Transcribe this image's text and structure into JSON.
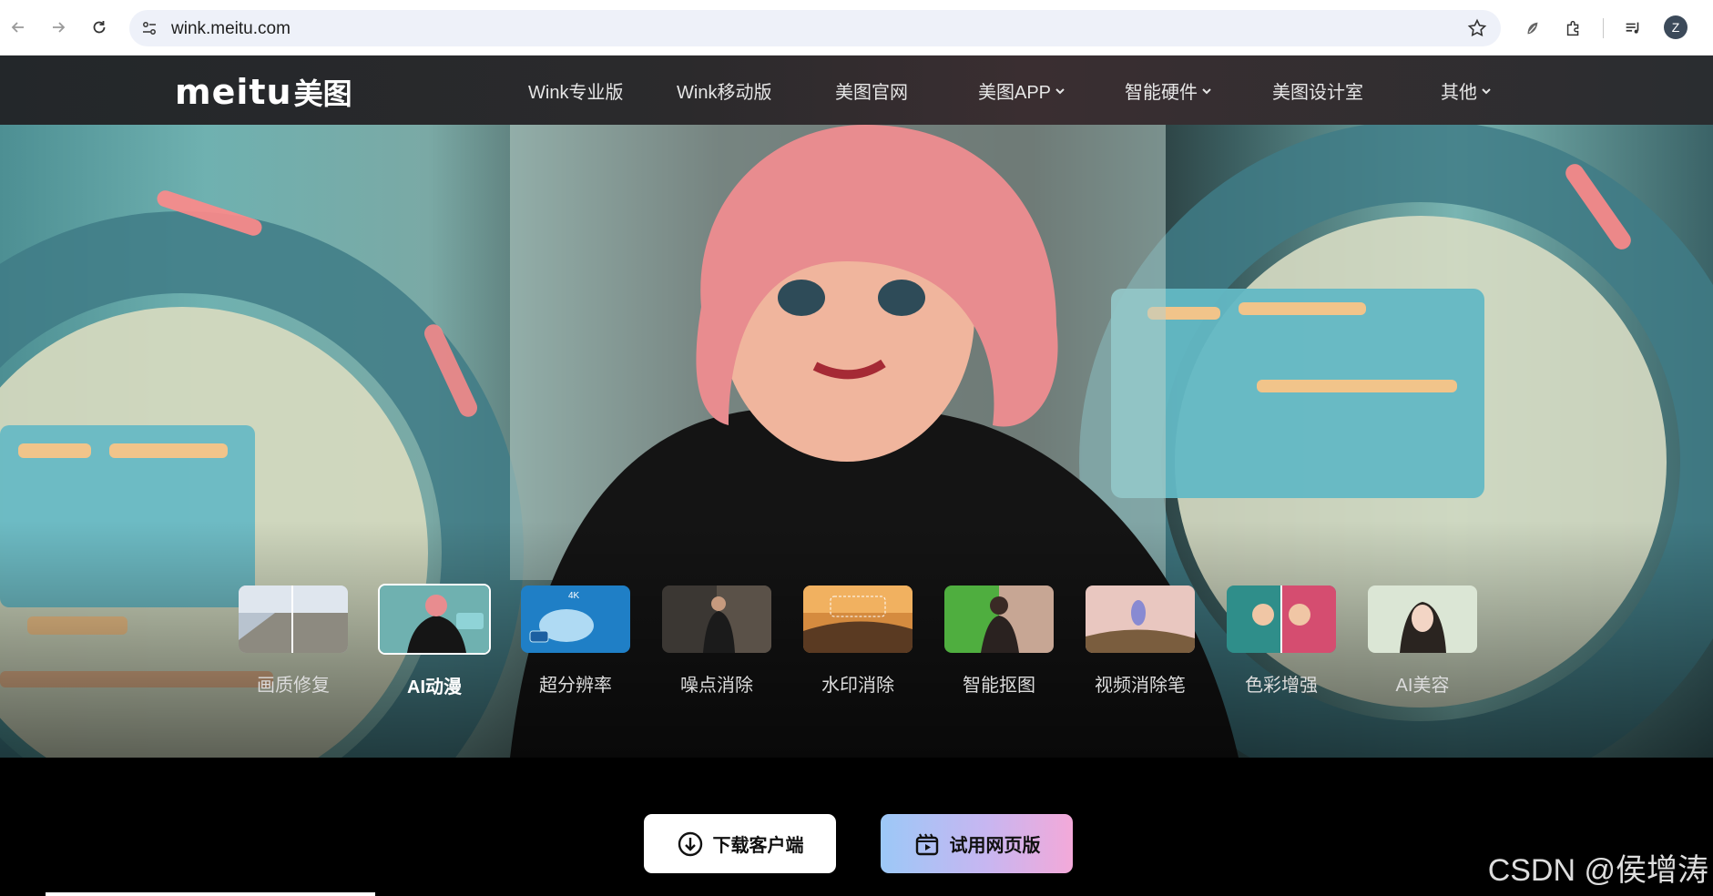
{
  "browser": {
    "url": "wink.meitu.com",
    "profile_initial": "Z"
  },
  "site": {
    "logo_latin": "meitu",
    "logo_cjk": "美图",
    "nav": [
      {
        "label": "Wink专业版"
      },
      {
        "label": "Wink移动版"
      },
      {
        "label": "美图官网"
      },
      {
        "label": "美图APP"
      },
      {
        "label": "智能硬件"
      },
      {
        "label": "美图设计室"
      },
      {
        "label": "其他"
      }
    ]
  },
  "features": [
    {
      "label": "画质修复"
    },
    {
      "label": "AI动漫"
    },
    {
      "label": "超分辨率"
    },
    {
      "label": "噪点消除"
    },
    {
      "label": "水印消除"
    },
    {
      "label": "智能抠图"
    },
    {
      "label": "视频消除笔"
    },
    {
      "label": "色彩增强"
    },
    {
      "label": "AI美容"
    }
  ],
  "active_feature": "AI动漫",
  "thumb_badge": "4K",
  "cta": {
    "download_label": "下载客户端",
    "web_label": "试用网页版"
  },
  "watermark": "CSDN @侯增涛",
  "colors": {
    "header_bg": "#2b2a2c",
    "cta_gradient_start": "#9cc8f7",
    "cta_gradient_end": "#f3a9d9"
  }
}
